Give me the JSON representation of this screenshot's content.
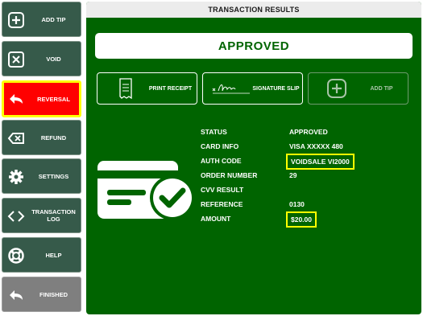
{
  "sidebar": {
    "items": [
      {
        "label": "ADD TIP",
        "icon": "plus-icon"
      },
      {
        "label": "VOID",
        "icon": "x-box-icon"
      },
      {
        "label": "REVERSAL",
        "icon": "undo-arrow-icon",
        "state": "active"
      },
      {
        "label": "REFUND",
        "icon": "backspace-icon"
      },
      {
        "label": "SETTINGS",
        "icon": "gear-icon"
      },
      {
        "label": "TRANSACTION LOG",
        "icon": "code-brackets-icon"
      },
      {
        "label": "HELP",
        "icon": "lifebuoy-icon"
      },
      {
        "label": "FINISHED",
        "icon": "return-arrow-icon",
        "state": "disabled"
      }
    ]
  },
  "main": {
    "title": "TRANSACTION RESULTS",
    "status": "APPROVED",
    "actions": {
      "print_receipt": "PRINT RECEIPT",
      "signature_slip": "SIGNATURE SLIP",
      "add_tip": "ADD TIP"
    },
    "details": [
      {
        "label": "STATUS",
        "value": "APPROVED"
      },
      {
        "label": "CARD INFO",
        "value": "VISA XXXXX 480"
      },
      {
        "label": "AUTH CODE",
        "value": "VOIDSALE VI2000",
        "highlight": true
      },
      {
        "label": "ORDER NUMBER",
        "value": "29"
      },
      {
        "label": "CVV RESULT",
        "value": ""
      },
      {
        "label": "REFERENCE",
        "value": "0130"
      },
      {
        "label": "AMOUNT",
        "value": "$20.00",
        "highlight": true
      }
    ]
  },
  "colors": {
    "panel_green": "#006400",
    "sidebar_button": "#365a4a",
    "active_button": "#ff0000",
    "highlight": "#ffff00",
    "disabled_button": "#7f7f7f"
  }
}
